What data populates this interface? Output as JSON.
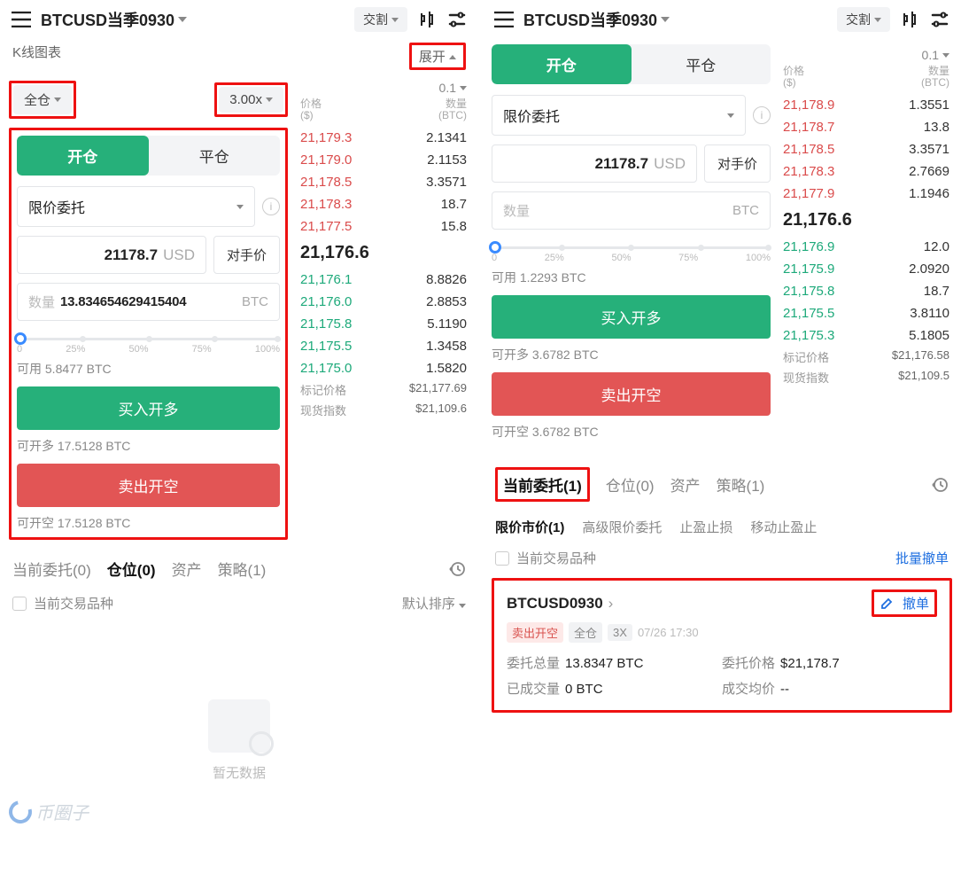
{
  "left": {
    "symbol": "BTCUSD当季0930",
    "topPill": "交割",
    "kline_label": "K线图表",
    "expand": "展开",
    "margin_mode": "全仓",
    "leverage": "3.00x",
    "tab_open": "开仓",
    "tab_close": "平仓",
    "order_type": "限价委托",
    "price_value": "21178.7",
    "price_unit": "USD",
    "opp_price_btn": "对手价",
    "qty_label": "数量",
    "qty_value": "13.834654629415404",
    "qty_unit": "BTC",
    "slider_labels": [
      "0",
      "25%",
      "50%",
      "75%",
      "100%"
    ],
    "avail_label": "可用",
    "avail_value": "5.8477 BTC",
    "buy_btn": "买入开多",
    "buy_avail_label": "可开多",
    "buy_avail_value": "17.5128 BTC",
    "sell_btn": "卖出开空",
    "sell_avail_label": "可开空",
    "sell_avail_value": "17.5128 BTC",
    "ob": {
      "group": "0.1",
      "head_price": "价格\n($)",
      "head_qty": "数量\n(BTC)",
      "asks": [
        [
          "21,179.3",
          "2.1341"
        ],
        [
          "21,179.0",
          "2.1153"
        ],
        [
          "21,178.5",
          "3.3571"
        ],
        [
          "21,178.3",
          "18.7"
        ],
        [
          "21,177.5",
          "15.8"
        ]
      ],
      "mid": "21,176.6",
      "bids": [
        [
          "21,176.1",
          "8.8826"
        ],
        [
          "21,176.0",
          "2.8853"
        ],
        [
          "21,175.8",
          "5.1190"
        ],
        [
          "21,175.5",
          "1.3458"
        ],
        [
          "21,175.0",
          "1.5820"
        ]
      ],
      "mark_label": "标记价格",
      "mark_value": "$21,177.69",
      "idx_label": "现货指数",
      "idx_value": "$21,109.6"
    },
    "btabs": [
      "当前委托(0)",
      "仓位(0)",
      "资产",
      "策略(1)"
    ],
    "btabs_active": 1,
    "filter_label": "当前交易品种",
    "sort_label": "默认排序",
    "empty_text": "暂无数据",
    "watermark": "币圈子"
  },
  "right": {
    "symbol": "BTCUSD当季0930",
    "topPill": "交割",
    "tab_open": "开仓",
    "tab_close": "平仓",
    "order_type": "限价委托",
    "price_value": "21178.7",
    "price_unit": "USD",
    "opp_price_btn": "对手价",
    "qty_placeholder": "数量",
    "qty_unit": "BTC",
    "slider_labels": [
      "0",
      "25%",
      "50%",
      "75%",
      "100%"
    ],
    "avail_label": "可用",
    "avail_value": "1.2293 BTC",
    "buy_btn": "买入开多",
    "buy_avail_label": "可开多",
    "buy_avail_value": "3.6782 BTC",
    "sell_btn": "卖出开空",
    "sell_avail_label": "可开空",
    "sell_avail_value": "3.6782 BTC",
    "ob": {
      "group": "0.1",
      "head_price": "价格\n($)",
      "head_qty": "数量\n(BTC)",
      "asks": [
        [
          "21,178.9",
          "1.3551"
        ],
        [
          "21,178.7",
          "13.8"
        ],
        [
          "21,178.5",
          "3.3571"
        ],
        [
          "21,178.3",
          "2.7669"
        ],
        [
          "21,177.9",
          "1.1946"
        ]
      ],
      "mid": "21,176.6",
      "bids": [
        [
          "21,176.9",
          "12.0"
        ],
        [
          "21,175.9",
          "2.0920"
        ],
        [
          "21,175.8",
          "18.7"
        ],
        [
          "21,175.5",
          "3.8110"
        ],
        [
          "21,175.3",
          "5.1805"
        ]
      ],
      "mark_label": "标记价格",
      "mark_value": "$21,176.58",
      "idx_label": "现货指数",
      "idx_value": "$21,109.5"
    },
    "btabs": [
      "当前委托(1)",
      "仓位(0)",
      "资产",
      "策略(1)"
    ],
    "btabs_active": 0,
    "subtabs": [
      "限价市价(1)",
      "高级限价委托",
      "止盈止损",
      "移动止盈止"
    ],
    "filter_label": "当前交易品种",
    "bulk_cancel": "批量撤单",
    "order": {
      "name": "BTCUSD0930",
      "edit": "edit",
      "cancel": "撤单",
      "side": "卖出开空",
      "mode": "全仓",
      "lev": "3X",
      "time": "07/26 17:30",
      "qty_label": "委托总量",
      "qty": "13.8347 BTC",
      "price_label": "委托价格",
      "price": "$21,178.7",
      "filled_label": "已成交量",
      "filled": "0 BTC",
      "avg_label": "成交均价",
      "avg": "--"
    }
  }
}
